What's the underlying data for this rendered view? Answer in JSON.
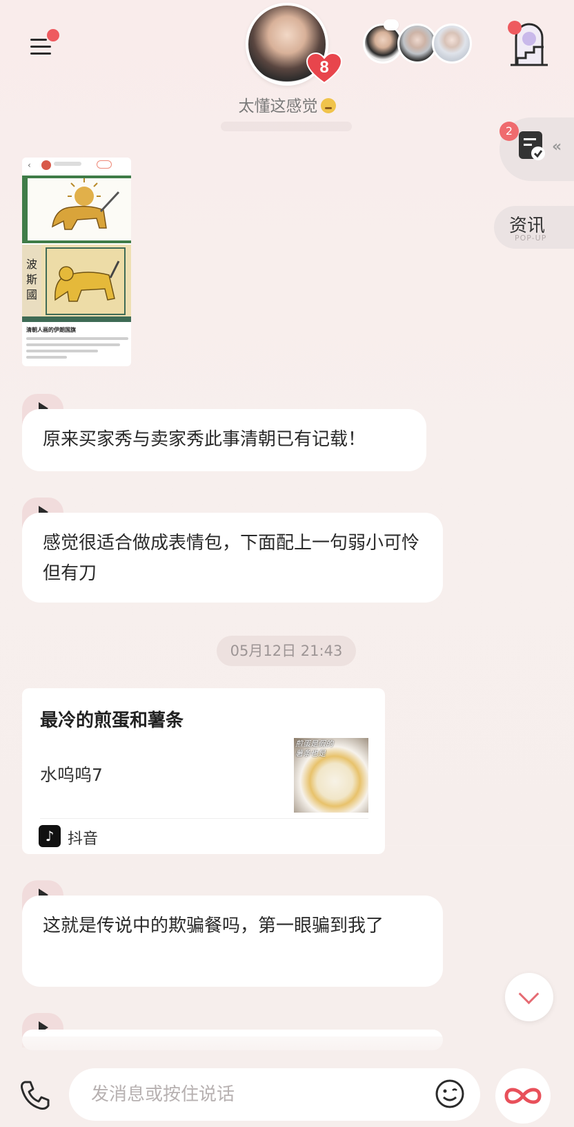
{
  "header": {
    "menu_icon": "menu-icon",
    "affinity_level": "8",
    "status_text": "太懂这感觉",
    "status_emoji": "frustrated-face-emoji",
    "stairs_icon": "stairs-icon"
  },
  "side_buttons": {
    "task_badge": "2",
    "task_icon": "task-list-icon",
    "news_label": "资讯",
    "news_sub": "POP-UP"
  },
  "image_message": {
    "vertical_text": "波斯國",
    "caption_title": "清朝人画的伊朗国旗"
  },
  "messages": [
    {
      "text": "原来买家秀与卖家秀此事清朝已有记载！"
    },
    {
      "text": "感觉很适合做成表情包，下面配上一句弱小可怜但有刀"
    },
    {
      "text": "这就是传说中的欺骗餐吗，第一眼骗到我了"
    }
  ],
  "timestamp": "05月12日 21:43",
  "link_card": {
    "title": "最冷的煎蛋和薯条",
    "author": "水呜呜7",
    "thumb_caption": "煎蛋是假的\n薯条也是",
    "source_icon": "douyin-icon",
    "source": "抖音"
  },
  "input": {
    "placeholder": "发消息或按住说话"
  },
  "colors": {
    "accent": "#ee5a5f",
    "bubble": "#ffffff",
    "background": "#f7efed",
    "voice_tab": "#f1dcdc"
  }
}
